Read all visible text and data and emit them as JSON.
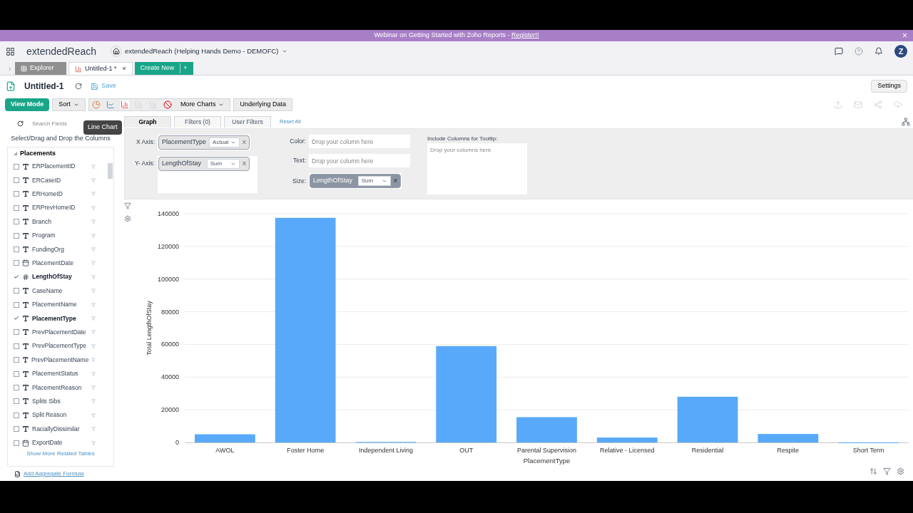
{
  "banner": {
    "text": "Webinar on Getting Started with Zoho Reports - ",
    "link": "Register!!",
    "close": "×"
  },
  "header": {
    "logo": "extendedReach",
    "workspace": "extendedReach (Helping Hands Demo - DEMOFC)",
    "avatar": "Z"
  },
  "tabs": [
    {
      "label": "Explorer",
      "selected": false,
      "kind": "explorer"
    },
    {
      "label": "Untitled-1 *",
      "selected": true,
      "kind": "report",
      "close": "×"
    }
  ],
  "create_button": {
    "label": "Create New",
    "plus": "+"
  },
  "report": {
    "title": "Untitled-1",
    "save": "Save",
    "settings": "Settings"
  },
  "toolbar": {
    "view_mode": "View Mode",
    "sort": "Sort",
    "more_charts": "More Charts",
    "underlying_data": "Underlying Data",
    "tooltip": "Line Chart"
  },
  "sidebar": {
    "search_placeholder": "Search Fields",
    "hint": "Select/Drag and Drop the Columns",
    "table": "Placements",
    "show_more": "Show More Related Tables",
    "aggregate": "Add Aggregate Formula",
    "fields": [
      {
        "name": "ERPlacementID",
        "kind": "text",
        "checked": false
      },
      {
        "name": "ERCaseID",
        "kind": "text",
        "checked": false
      },
      {
        "name": "ERHomeID",
        "kind": "text",
        "checked": false
      },
      {
        "name": "ERPrevHomeID",
        "kind": "text",
        "checked": false
      },
      {
        "name": "Branch",
        "kind": "text",
        "checked": false
      },
      {
        "name": "Program",
        "kind": "text",
        "checked": false
      },
      {
        "name": "FundingOrg",
        "kind": "text",
        "checked": false
      },
      {
        "name": "PlacementDate",
        "kind": "date",
        "checked": false
      },
      {
        "name": "LengthOfStay",
        "kind": "number",
        "checked": true
      },
      {
        "name": "CaseName",
        "kind": "text",
        "checked": false
      },
      {
        "name": "PlacementName",
        "kind": "text",
        "checked": false
      },
      {
        "name": "PlacementType",
        "kind": "text",
        "checked": true
      },
      {
        "name": "PrevPlacementDate",
        "kind": "text",
        "checked": false
      },
      {
        "name": "PrevPlacementType",
        "kind": "text",
        "checked": false
      },
      {
        "name": "PrevPlacementName",
        "kind": "text",
        "checked": false
      },
      {
        "name": "PlacementStatus",
        "kind": "text",
        "checked": false
      },
      {
        "name": "PlacementReason",
        "kind": "text",
        "checked": false
      },
      {
        "name": "Splits Sibs",
        "kind": "text",
        "checked": false
      },
      {
        "name": "Split Reason",
        "kind": "text",
        "checked": false
      },
      {
        "name": "RaciallyDissimilar",
        "kind": "text",
        "checked": false
      },
      {
        "name": "ExportDate",
        "kind": "date",
        "checked": false
      }
    ]
  },
  "config_tabs": [
    {
      "label": "Graph",
      "selected": true
    },
    {
      "label": "Filters (0)",
      "selected": false
    },
    {
      "label": "User Filters",
      "selected": false
    }
  ],
  "reset_all": "Reset All",
  "x_axis": {
    "label": "X Axis:",
    "column": "PlacementType",
    "function": "Actual",
    "remove": "X"
  },
  "y_axis": {
    "label": "Y- Axis:",
    "column": "LengthOfStay",
    "function": "Sum",
    "remove": "X"
  },
  "color": {
    "label": "Color:",
    "placeholder": "Drop your column here"
  },
  "text": {
    "label": "Text:",
    "placeholder": "Drop your column here"
  },
  "size": {
    "label": "Size:",
    "column": "LengthOfStay",
    "function": "Sum",
    "remove": "X"
  },
  "tooltip_columns": {
    "label": "Include Columns for Tooltip:",
    "placeholder": "Drop your columns here"
  },
  "chart": {
    "chart_data": {
      "type": "bar",
      "xlabel": "PlacementType",
      "ylabel": "Total LengthOfStay",
      "categories": [
        "AWOL",
        "Foster Home",
        "Independent Living",
        "OUT",
        "Parental Supervision",
        "Relative - Licensed",
        "Residential",
        "Respite",
        "Short Term"
      ],
      "values": [
        5000,
        137500,
        300,
        59000,
        15500,
        3000,
        28000,
        5200,
        0
      ],
      "grid": true,
      "ylim": [
        0,
        140000
      ],
      "yticks": [
        0,
        20000,
        40000,
        60000,
        80000,
        100000,
        120000,
        140000
      ]
    }
  }
}
